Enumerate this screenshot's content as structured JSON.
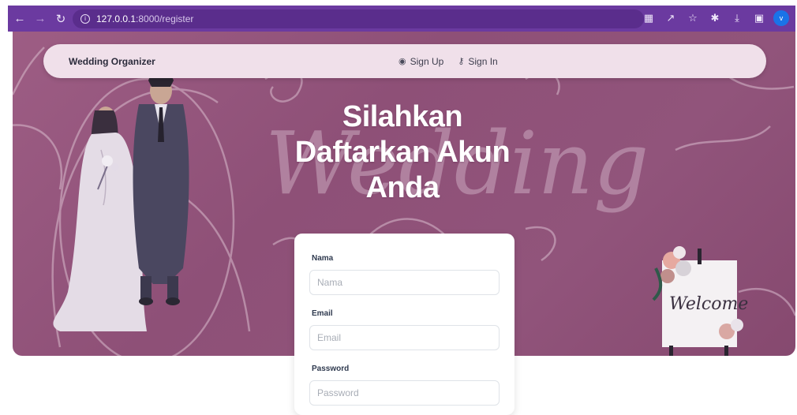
{
  "browser": {
    "url_host": "127.0.0.1",
    "url_path": ":8000/register",
    "profile_initial": "v"
  },
  "navbar": {
    "brand": "Wedding Organizer",
    "links": [
      {
        "label": "Sign Up",
        "icon": "user-icon"
      },
      {
        "label": "Sign In",
        "icon": "key-icon"
      }
    ]
  },
  "hero": {
    "title_line1": "Silahkan",
    "title_line2": "Daftarkan Akun",
    "title_line3": "Anda",
    "background_script": "Wedding",
    "sign_text": "Welcome"
  },
  "form": {
    "fields": [
      {
        "label": "Nama",
        "placeholder": "Nama",
        "value": ""
      },
      {
        "label": "Email",
        "placeholder": "Email",
        "value": ""
      },
      {
        "label": "Password",
        "placeholder": "Password",
        "value": ""
      }
    ]
  },
  "colors": {
    "chrome": "#6b3aa0",
    "hero": "#8e5077",
    "navbar": "#f0e0ea"
  }
}
